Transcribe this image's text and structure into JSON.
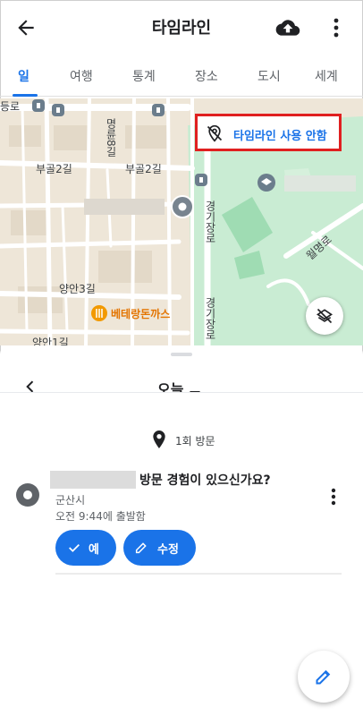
{
  "app_bar": {
    "title": "타임라인",
    "back_icon": "arrow-back-icon",
    "upload_icon": "cloud-upload-icon",
    "more_icon": "more-vert-icon"
  },
  "tabs": [
    {
      "label": "일",
      "active": true
    },
    {
      "label": "여행",
      "active": false
    },
    {
      "label": "통계",
      "active": false
    },
    {
      "label": "장소",
      "active": false
    },
    {
      "label": "도시",
      "active": false
    },
    {
      "label": "세계",
      "active": false
    }
  ],
  "map": {
    "timeline_notice": "타임라인 사용 안함",
    "labels": {
      "top_left_fragment": "등로",
      "vertical_road": "명륜8길",
      "street_1": "부골2길",
      "street_2": "부골2길",
      "street_3": "양안3길",
      "street_4": "양안1길",
      "restaurant": "베테랑돈까스",
      "gyeongjang_1": "경기장로",
      "gyeongjang_2": "경기장로",
      "diagonal_road": "월명로"
    },
    "layers_icon": "layers-off-icon"
  },
  "sheet": {
    "day_label": "오늘",
    "visit_summary": "1회 방문",
    "visit_card": {
      "question": "방문 경험이 있으신가요?",
      "city": "군산시",
      "departure": "오전 9:44에 출발함",
      "yes_label": "예",
      "edit_label": "수정"
    }
  },
  "fab_icon": "edit-pencil-icon",
  "colors": {
    "accent": "#1a73e8",
    "highlight_border": "#e02020",
    "map_land": "#eee6d8",
    "map_park": "#c9ecd3",
    "map_road": "#ffffff"
  }
}
